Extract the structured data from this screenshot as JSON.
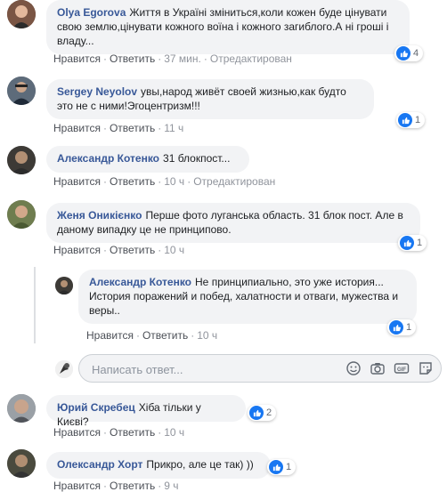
{
  "actions": {
    "like": "Нравится",
    "reply": "Ответить",
    "edited": "Отредактирован"
  },
  "comments": [
    {
      "author": "Olya Egorova",
      "text": "Життя в Україні зміниться,коли кожен буде цінувати свою землю,цінувати кожного воїна і кожного загиблого.А ні гроші і владу...",
      "time": "37 мин.",
      "reactions": "4"
    },
    {
      "author": "Sergey Neyolov",
      "text": "увы,народ живёт своей жизнью,как будто это не с ними!Эгоцентризм!!!",
      "time": "11 ч",
      "reactions": "1"
    },
    {
      "author": "Александр Котенко",
      "text": "31 блокпост...",
      "time": "10 ч"
    },
    {
      "author": "Женя Оникієнко",
      "text": "Перше фото луганська область. 31 блок пост. Але в даному випадку це не принципово.",
      "time": "10 ч",
      "reactions": "1"
    },
    {
      "author": "Александр Котенко",
      "text": "Не принципиально, это уже история... История поражений и побед, халатности и отваги, мужества и веры..",
      "time": "10 ч",
      "reactions": "1"
    },
    {
      "author": "Юрий Скребец",
      "text": "Хіба тільки у Києві?",
      "time": "10 ч",
      "reactions": "2"
    },
    {
      "author": "Олександр Хорт",
      "text": "Прикро, але це так) ))",
      "time": "9 ч",
      "reactions": "1"
    }
  ],
  "reply_box": {
    "placeholder": "Написать ответ..."
  },
  "colors": {
    "author": "#385898",
    "bubble": "#f2f3f5",
    "like": "#1877f2",
    "meta": "#90949c"
  }
}
